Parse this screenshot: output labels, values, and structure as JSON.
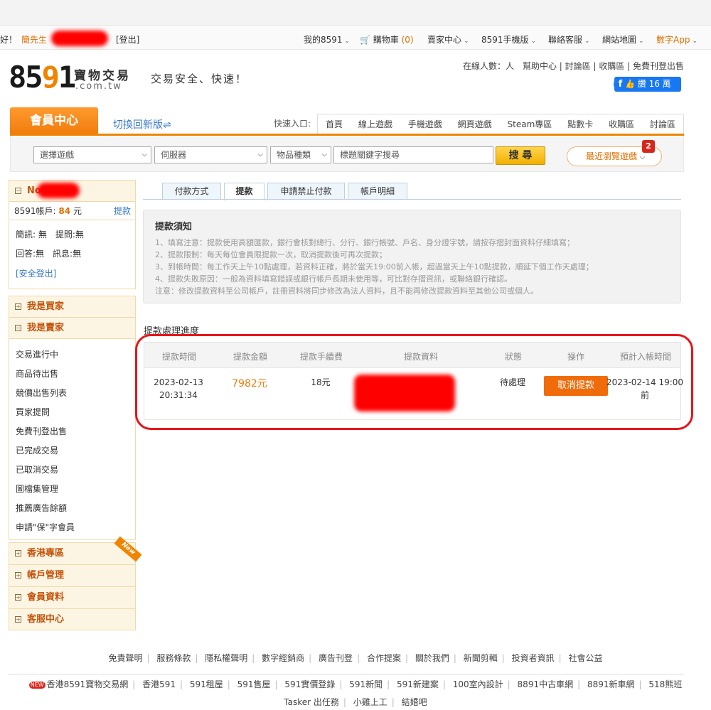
{
  "topbar": {
    "greeting": "好！",
    "user_name": "簡先生",
    "logout": "[登出]",
    "my8591": "我的8591",
    "cart": "購物車",
    "cart_count": "(0)",
    "seller_center": "賣家中心",
    "mobile": "8591手機版",
    "contact": "聯絡客服",
    "sitemap": "網站地圖",
    "app": "數字App"
  },
  "header": {
    "logo_digits_1": "85",
    "logo_digits_2": "9",
    "logo_digits_3": "1",
    "logo_cn": "寶物交易",
    "logo_domain": ".com.tw",
    "slogan": "交易安全、快速！",
    "links": "在線人數：人　幫助中心 | 討論區 | 收購區 | 免費刊登出售",
    "fb_like": "讚 16 萬"
  },
  "nav": {
    "member_center": "會員中心",
    "switch_new": "切換回新版⇌",
    "quick_label": "快速入口:",
    "quick_items": [
      "首頁",
      "線上遊戲",
      "手機遊戲",
      "網頁遊戲",
      "Steam專區",
      "點數卡",
      "收購區",
      "討論區"
    ]
  },
  "search": {
    "game": "選擇遊戲",
    "server": "伺服器",
    "item_type": "物品種類",
    "keyword_placeholder": "標題關鍵字搜尋",
    "button": "搜 尋",
    "recent": "最近瀏覽遊戲",
    "recent_badge": "2"
  },
  "sidebar": {
    "account_head": "No",
    "balance_label": "8591帳戶:",
    "balance_value": "84",
    "balance_unit": "元",
    "withdraw_link": "提款",
    "line1": "簡訊: 無　提問:無",
    "line2": "回答:無　訊息:無",
    "secure_logout": "[安全登出]",
    "buyer": "我是買家",
    "seller": "我是賣家",
    "seller_items": [
      "交易進行中",
      "商品待出售",
      "競價出售列表",
      "買家提問",
      "免費刊登出售",
      "已完成交易",
      "已取消交易",
      "圖檔集管理",
      "推薦廣告餘額",
      "申請\"保\"字會員"
    ],
    "hk": "香港專區",
    "hk_new": "New",
    "account_mgmt": "帳戶管理",
    "member_info": "會員資料",
    "service": "客服中心"
  },
  "tabs": [
    "付款方式",
    "提款",
    "申請禁止付款",
    "帳戶明細"
  ],
  "notice": {
    "title": "提款須知",
    "lines": [
      "1、填寫注意：提款使用高額匯款，銀行會核對總行、分行、銀行帳號、戶名、身分證字號，請按存摺封面資料仔細填寫；",
      "2、提款限制：每天每位會員限提款一次，取消提款後可再次提款；",
      "3、到帳時間：每工作天上午10點處理，若資料正確，將於當天19:00前入帳，超過當天上午10點提款，順延下個工作天處理；",
      "4、提款失敗原因：一般為資料填寫錯誤或銀行帳戶長期未使用等，可比對存摺資訊，或聯絡銀行確認。",
      "注意：修改提款資料至公司帳戶，註冊資料將同步修改為法人資料，且不能再修改提款資料至其他公司或個人。"
    ]
  },
  "progress": {
    "title": "提款處理進度",
    "columns": [
      "提款時間",
      "提款金額",
      "提款手續費",
      "提款資料",
      "狀態",
      "操作",
      "預計入帳時間"
    ],
    "row": {
      "date": "2023-02-13",
      "time": "20:31:34",
      "amount": "7982元",
      "fee": "18元",
      "status": "待處理",
      "action": "取消提款",
      "eta1": "2023-02-14 19:00",
      "eta2": "前"
    }
  },
  "footer": {
    "links": [
      "免責聲明",
      "服務條款",
      "隱私權聲明",
      "數字經銷商",
      "廣告刊登",
      "合作提案",
      "關於我們",
      "新聞剪輯",
      "投資者資訊",
      "社會公益"
    ],
    "new_tag": "NEW",
    "sites": [
      "香港8591寶物交易網",
      "香港591",
      "591租屋",
      "591售屋",
      "591實價登錄",
      "591新聞",
      "591新建案",
      "100室內設計",
      "8891中古車網",
      "8891新車網",
      "518熊班"
    ],
    "sites2": [
      "Tasker 出任務",
      "小雞上工",
      "結婚吧"
    ]
  }
}
